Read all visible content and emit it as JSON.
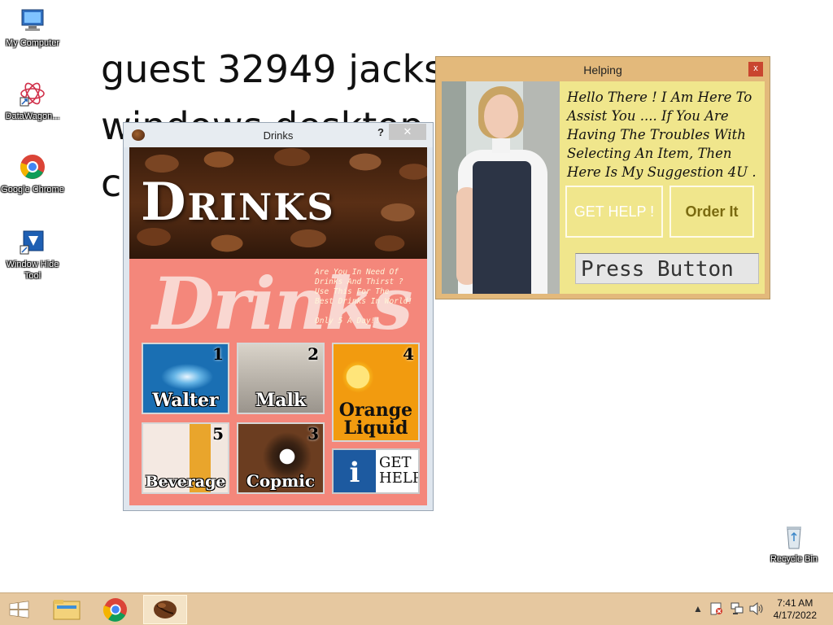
{
  "desktop": {
    "icons": [
      {
        "label": "My Computer",
        "icon": "computer-icon"
      },
      {
        "label": "DataWagon...",
        "icon": "datawagon-icon"
      },
      {
        "label": "Google Chrome",
        "icon": "chrome-icon"
      },
      {
        "label": "Window Hide Tool",
        "icon": "window-hide-icon"
      },
      {
        "label": "Recycle Bin",
        "icon": "recycle-bin-icon"
      }
    ],
    "background_lines": [
      "guest 32949 jacks",
      "windows desktop",
      "c"
    ]
  },
  "drinks_window": {
    "title": "Drinks",
    "help_glyph": "?",
    "close_glyph": "✕",
    "banner_title": "Drinks",
    "script_text": "Drinks",
    "promo_lines": [
      "Are You In Need Of",
      "Drinks And Thirst ?",
      "Use This For The",
      "Best Drinks In World!",
      "",
      "Only 5 A Day!!"
    ],
    "tiles": [
      {
        "number": "1",
        "name": "Walter"
      },
      {
        "number": "2",
        "name": "Malk"
      },
      {
        "number": "4",
        "name": "Orange Liquid"
      },
      {
        "number": "5",
        "name": "Beverage"
      },
      {
        "number": "3",
        "name": "Copmic"
      }
    ],
    "get_help": {
      "icon_glyph": "i",
      "line1": "GET",
      "line2": "HELP"
    }
  },
  "helping_window": {
    "title": "Helping",
    "close_glyph": "x",
    "message": "Hello There ! I Am Here To Assist You .... If You Are Having The Troubles With Selecting An Item, Then Here Is My Suggestion 4U .",
    "get_help_button": "GET HELP !",
    "order_button": "Order It",
    "input_value": "Press Button"
  },
  "taskbar": {
    "time": "7:41 AM",
    "date": "4/17/2022",
    "tray_arrow": "▲"
  },
  "colors": {
    "drinks_bg": "#f4877b",
    "helping_bg": "#f0e68c",
    "taskbar": "#e6c8a0"
  }
}
